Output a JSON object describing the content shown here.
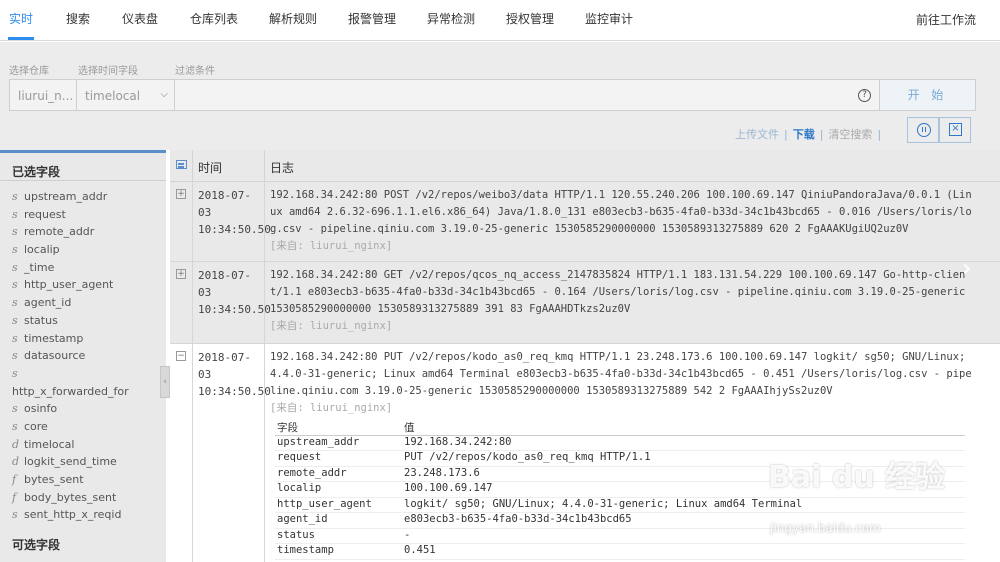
{
  "nav": {
    "tabs": [
      "实时",
      "搜索",
      "仪表盘",
      "仓库列表",
      "解析规则",
      "报警管理",
      "异常检测",
      "授权管理",
      "监控审计"
    ],
    "right_link": "前往工作流",
    "accent": "#2d8cf0"
  },
  "filters": {
    "repo_label": "选择仓库",
    "time_field_label": "选择时间字段",
    "condition_label": "过滤条件",
    "repo_value": "liurui_n...",
    "time_field_value": "timelocal",
    "condition_placeholder": "",
    "help_icon": "?",
    "start_button": "开 始"
  },
  "actions": {
    "upload": "上传文件",
    "download": "下载",
    "clear": "清空搜索"
  },
  "sidebar": {
    "selected_heading": "已选字段",
    "optional_heading": "可选字段",
    "fields": [
      {
        "type": "s",
        "name": "upstream_addr"
      },
      {
        "type": "s",
        "name": "request"
      },
      {
        "type": "s",
        "name": "remote_addr"
      },
      {
        "type": "s",
        "name": "localip"
      },
      {
        "type": "s",
        "name": "_time"
      },
      {
        "type": "s",
        "name": "http_user_agent"
      },
      {
        "type": "s",
        "name": "agent_id"
      },
      {
        "type": "s",
        "name": "status"
      },
      {
        "type": "s",
        "name": "timestamp"
      },
      {
        "type": "s",
        "name": "datasource"
      },
      {
        "type": "s",
        "name": ""
      },
      {
        "type": "",
        "name": "http_x_forwarded_for"
      },
      {
        "type": "s",
        "name": "osinfo"
      },
      {
        "type": "s",
        "name": "core"
      },
      {
        "type": "d",
        "name": "timelocal"
      },
      {
        "type": "d",
        "name": "logkit_send_time"
      },
      {
        "type": "f",
        "name": "bytes_sent"
      },
      {
        "type": "f",
        "name": "body_bytes_sent"
      },
      {
        "type": "s",
        "name": "sent_http_x_reqid"
      }
    ]
  },
  "table": {
    "col_time": "时间",
    "col_log": "日志",
    "rows": [
      {
        "toggle": "+",
        "time": "2018-07-03 10:34:50.50",
        "log": "192.168.34.242:80 POST /v2/repos/weibo3/data HTTP/1.1 120.55.240.206 100.100.69.147 QiniuPandoraJava/0.0.1 (Linux amd64 2.6.32-696.1.1.el6.x86_64) Java/1.8.0_131 e803ecb3-b635-4fa0-b33d-34c1b43bcd65 - 0.016 /Users/loris/log.csv - pipeline.qiniu.com 3.19.0-25-generic 1530585290000000 1530589313275889 620 2 FgAAAKUgiUQ2uz0V",
        "source": "[来自: liurui_nginx]"
      },
      {
        "toggle": "+",
        "time": "2018-07-03 10:34:50.50",
        "log": "192.168.34.242:80 GET /v2/repos/qcos_nq_access_2147835824 HTTP/1.1 183.131.54.229 100.100.69.147 Go-http-client/1.1 e803ecb3-b635-4fa0-b33d-34c1b43bcd65 - 0.164 /Users/loris/log.csv - pipeline.qiniu.com 3.19.0-25-generic 1530585290000000 1530589313275889 391 83 FgAAAHDTkzs2uz0V",
        "source": "[来自: liurui_nginx]"
      },
      {
        "toggle": "−",
        "time": "2018-07-03 10:34:50.50",
        "log": "192.168.34.242:80 PUT /v2/repos/kodo_as0_req_kmq HTTP/1.1 23.248.173.6 100.100.69.147 logkit/ sg50; GNU/Linux; 4.4.0-31-generic; Linux amd64 Terminal e803ecb3-b635-4fa0-b33d-34c1b43bcd65 - 0.451 /Users/loris/log.csv - pipeline.qiniu.com 3.19.0-25-generic 1530585290000000 1530589313275889 542 2 FgAAAIhjySs2uz0V",
        "source": "[来自: liurui_nginx]"
      }
    ]
  },
  "detail": {
    "col_field": "字段",
    "col_value": "值",
    "rows": [
      {
        "k": "upstream_addr",
        "v": "192.168.34.242:80"
      },
      {
        "k": "request",
        "v": "PUT /v2/repos/kodo_as0_req_kmq HTTP/1.1"
      },
      {
        "k": "remote_addr",
        "v": "23.248.173.6"
      },
      {
        "k": "localip",
        "v": "100.100.69.147"
      },
      {
        "k": "http_user_agent",
        "v": "logkit/ sg50; GNU/Linux; 4.4.0-31-generic; Linux amd64 Terminal"
      },
      {
        "k": "agent_id",
        "v": "e803ecb3-b635-4fa0-b33d-34c1b43bcd65"
      },
      {
        "k": "status",
        "v": "-"
      },
      {
        "k": "timestamp",
        "v": "0.451"
      }
    ]
  },
  "watermark": {
    "logo": "Bai du 经验",
    "url": "jingyan.baidu.com"
  }
}
